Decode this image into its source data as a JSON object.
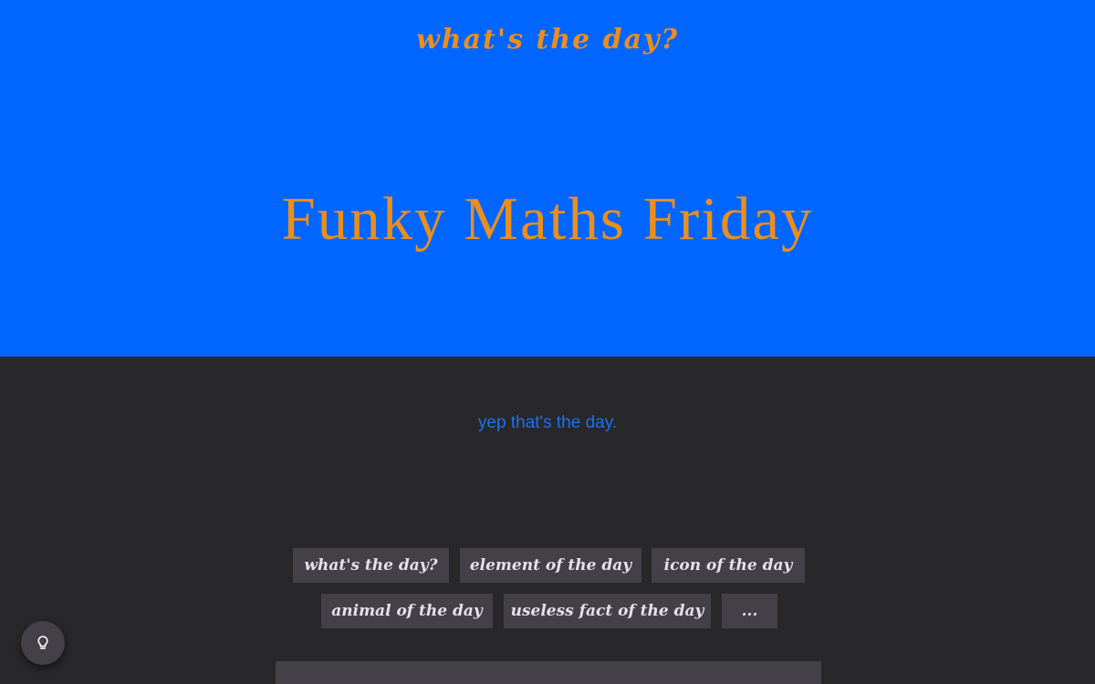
{
  "header": {
    "site_title": "what's the day?",
    "day_name": "Funky Maths Friday"
  },
  "main": {
    "confirmation": "yep that's the day."
  },
  "nav": {
    "row1": [
      {
        "label": "what's the day?"
      },
      {
        "label": "element of the day"
      },
      {
        "label": "icon of the day"
      }
    ],
    "row2": [
      {
        "label": "animal of the day"
      },
      {
        "label": "useless fact of the day"
      },
      {
        "label": "..."
      }
    ]
  },
  "fab": {
    "icon": "lightbulb-icon"
  },
  "colors": {
    "hero_background": "#0066ff",
    "accent_orange": "#ec8e1c",
    "page_background": "#28272a",
    "button_background": "#434147",
    "confirmation_text": "#1a73f0",
    "button_text": "#e4e2e6"
  }
}
